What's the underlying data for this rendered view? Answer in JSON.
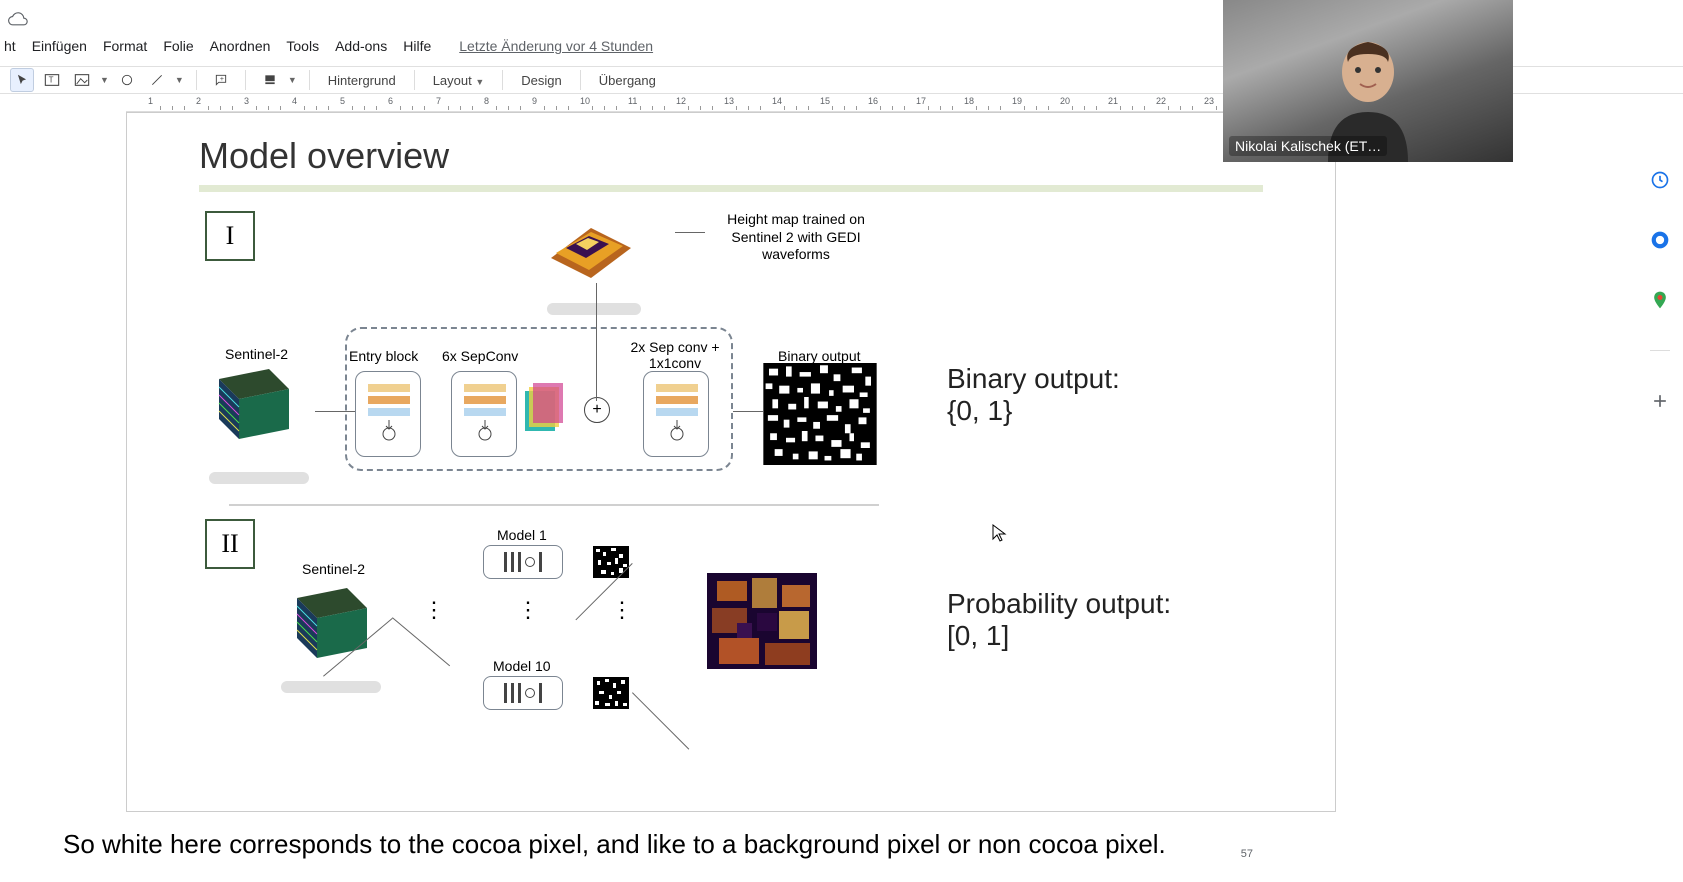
{
  "menu": {
    "items": [
      "ht",
      "Einfügen",
      "Format",
      "Folie",
      "Anordnen",
      "Tools",
      "Add-ons",
      "Hilfe"
    ],
    "last_edit": "Letzte Änderung vor 4 Stunden"
  },
  "toolbar": {
    "background": "Hintergrund",
    "layout": "Layout",
    "design": "Design",
    "transition": "Übergang"
  },
  "ruler": {
    "numbers": [
      "1",
      "2",
      "3",
      "4",
      "5",
      "6",
      "7",
      "8",
      "9",
      "10",
      "11",
      "12",
      "13",
      "14",
      "15",
      "16",
      "17",
      "18",
      "19",
      "20",
      "21",
      "22",
      "23"
    ]
  },
  "slide": {
    "title": "Model overview",
    "roman1": "I",
    "roman2": "II",
    "heightmap_caption": "Height map trained on Sentinel 2 with GEDI waveforms",
    "sentinel_a": "Sentinel-2",
    "sentinel_b": "Sentinel-2",
    "entry_block": "Entry block",
    "sepconv6": "6x SepConv",
    "sepconv2": "2x Sep conv + 1x1conv",
    "binary_output_label": "Binary output",
    "plus": "+",
    "model1": "Model 1",
    "model10": "Model 10",
    "binary_text_a": "Binary output:",
    "binary_text_b": "{0, 1}",
    "prob_text_a": "Probability output:",
    "prob_text_b": "[0, 1]",
    "dots": "⋮"
  },
  "webcam": {
    "name": "Nikolai Kalischek (ET…"
  },
  "caption": {
    "text": "So white here corresponds to the cocoa pixel, and like to a background pixel or non cocoa pixel.",
    "num": "57"
  },
  "sidebar_icons": [
    "calendar-icon",
    "keep-icon",
    "tasks-icon",
    "maps-icon",
    "plus-icon"
  ]
}
